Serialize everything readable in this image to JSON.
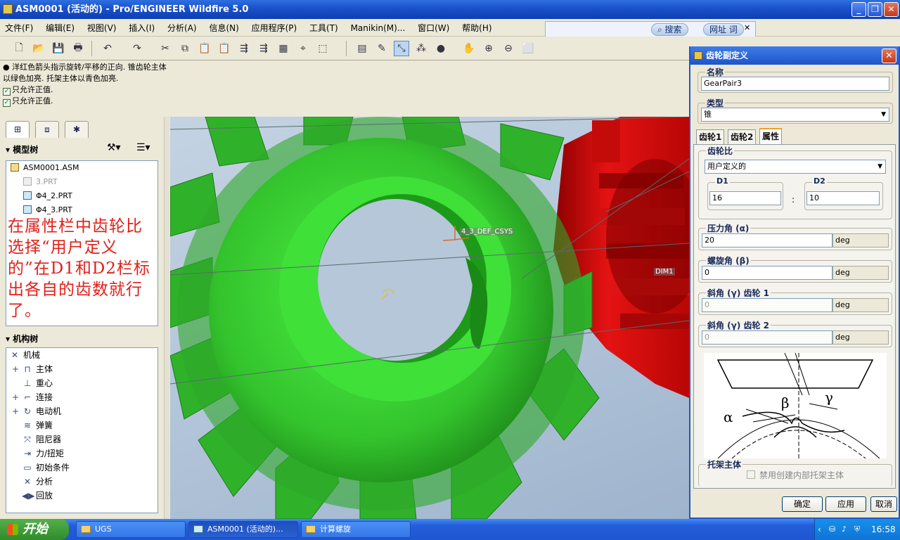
{
  "window": {
    "title": "ASM0001 (活动的) - Pro/ENGINEER Wildfire 5.0",
    "min": "_",
    "max": "❐",
    "close": "✕"
  },
  "menu": [
    "文件(F)",
    "编辑(E)",
    "视图(V)",
    "插入(I)",
    "分析(A)",
    "信息(N)",
    "应用程序(P)",
    "工具(T)",
    "Manikin(M)...",
    "窗口(W)",
    "帮助(H)"
  ],
  "search": {
    "search_label": "搜索",
    "url_label": "网址 词",
    "close": "✕"
  },
  "messages": {
    "line1": "● 洋红色箭头指示旋转/平移的正向. 锥齿轮主体",
    "line2": "以绿色加亮. 托架主体以青色加亮.",
    "line3": "只允许正值.",
    "line4": "只允许正值."
  },
  "left": {
    "model_tree_title": "模型树",
    "model_items": [
      "ASM0001.ASM",
      "3.PRT",
      "Φ4_2.PRT",
      "Φ4_3.PRT"
    ],
    "annotation": "在属性栏中齿轮比选择“用户定义的”在D1和D2栏标出各自的齿数就行了。",
    "mech_tree_title": "机构树",
    "mech_items": [
      "机械",
      "主体",
      "重心",
      "连接",
      "电动机",
      "弹簧",
      "阻尼器",
      "力/扭矩",
      "初始条件",
      "分析",
      "回放"
    ]
  },
  "viewport": {
    "csys_label": "4_3_DEF_CSYS",
    "dim_label": "DIM1"
  },
  "dialog": {
    "title": "齿轮副定义",
    "name_label": "名称",
    "name_value": "GearPair3",
    "type_label": "类型",
    "type_value": "锥",
    "tabs": [
      "齿轮1",
      "齿轮2",
      "属性"
    ],
    "ratio_label": "齿轮比",
    "ratio_value": "用户定义的",
    "d1_label": "D1",
    "d1_value": "16",
    "colon": ":",
    "d2_label": "D2",
    "d2_value": "10",
    "pressure_label": "压力角 (α)",
    "pressure_value": "20",
    "helix_label": "螺旋角 (β)",
    "helix_value": "0",
    "bevel1_label": "斜角 (γ) 齿轮 1",
    "bevel1_value": "0",
    "bevel2_label": "斜角 (γ) 齿轮 2",
    "bevel2_value": "0",
    "unit": "deg",
    "carrier_label": "托架主体",
    "carrier_checkbox": "禁用创建内部托架主体",
    "ok": "确定",
    "apply": "应用",
    "cancel": "取消"
  },
  "taskbar": {
    "start": "开始",
    "tasks": [
      "UGS",
      "ASM0001 (活动的)...",
      "计算螺旋"
    ],
    "time": "16:58"
  },
  "colors": {
    "gear_green": "#3bdc34",
    "gear_red": "#e01010",
    "title_blue": "#1a50c8"
  }
}
